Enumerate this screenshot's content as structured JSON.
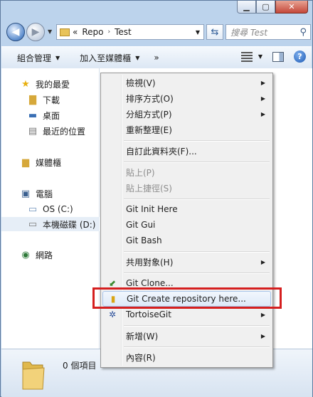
{
  "address": {
    "prefix": "«",
    "crumbs": [
      "Repo",
      "Test"
    ],
    "sep": "›"
  },
  "search": {
    "placeholder": "搜尋 Test"
  },
  "toolbar": {
    "organize": "組合管理",
    "include_library": "加入至媒體櫃",
    "more": "»"
  },
  "nav": {
    "favorites": "我的最愛",
    "downloads": "下載",
    "desktop": "桌面",
    "recent": "最近的位置",
    "libraries": "媒體櫃",
    "computer": "電腦",
    "os_drive": "OS (C:)",
    "local_drive": "本機磁碟 (D:)",
    "network": "網路"
  },
  "status": {
    "items": "0 個項目"
  },
  "menu": {
    "view": "檢視(V)",
    "sort_by": "排序方式(O)",
    "group_by": "分組方式(P)",
    "refresh": "重新整理(E)",
    "customize": "自訂此資料夾(F)...",
    "paste": "貼上(P)",
    "paste_shortcut": "貼上捷徑(S)",
    "git_init": "Git Init Here",
    "git_gui": "Git Gui",
    "git_bash": "Git Bash",
    "share_with": "共用對象(H)",
    "git_clone": "Git Clone...",
    "git_create_repo": "Git Create repository here...",
    "tortoisegit": "TortoiseGit",
    "new": "新增(W)",
    "properties": "內容(R)"
  },
  "colors": {
    "highlight_box": "#d51f1f",
    "window_frame": "#bcd3ec"
  }
}
